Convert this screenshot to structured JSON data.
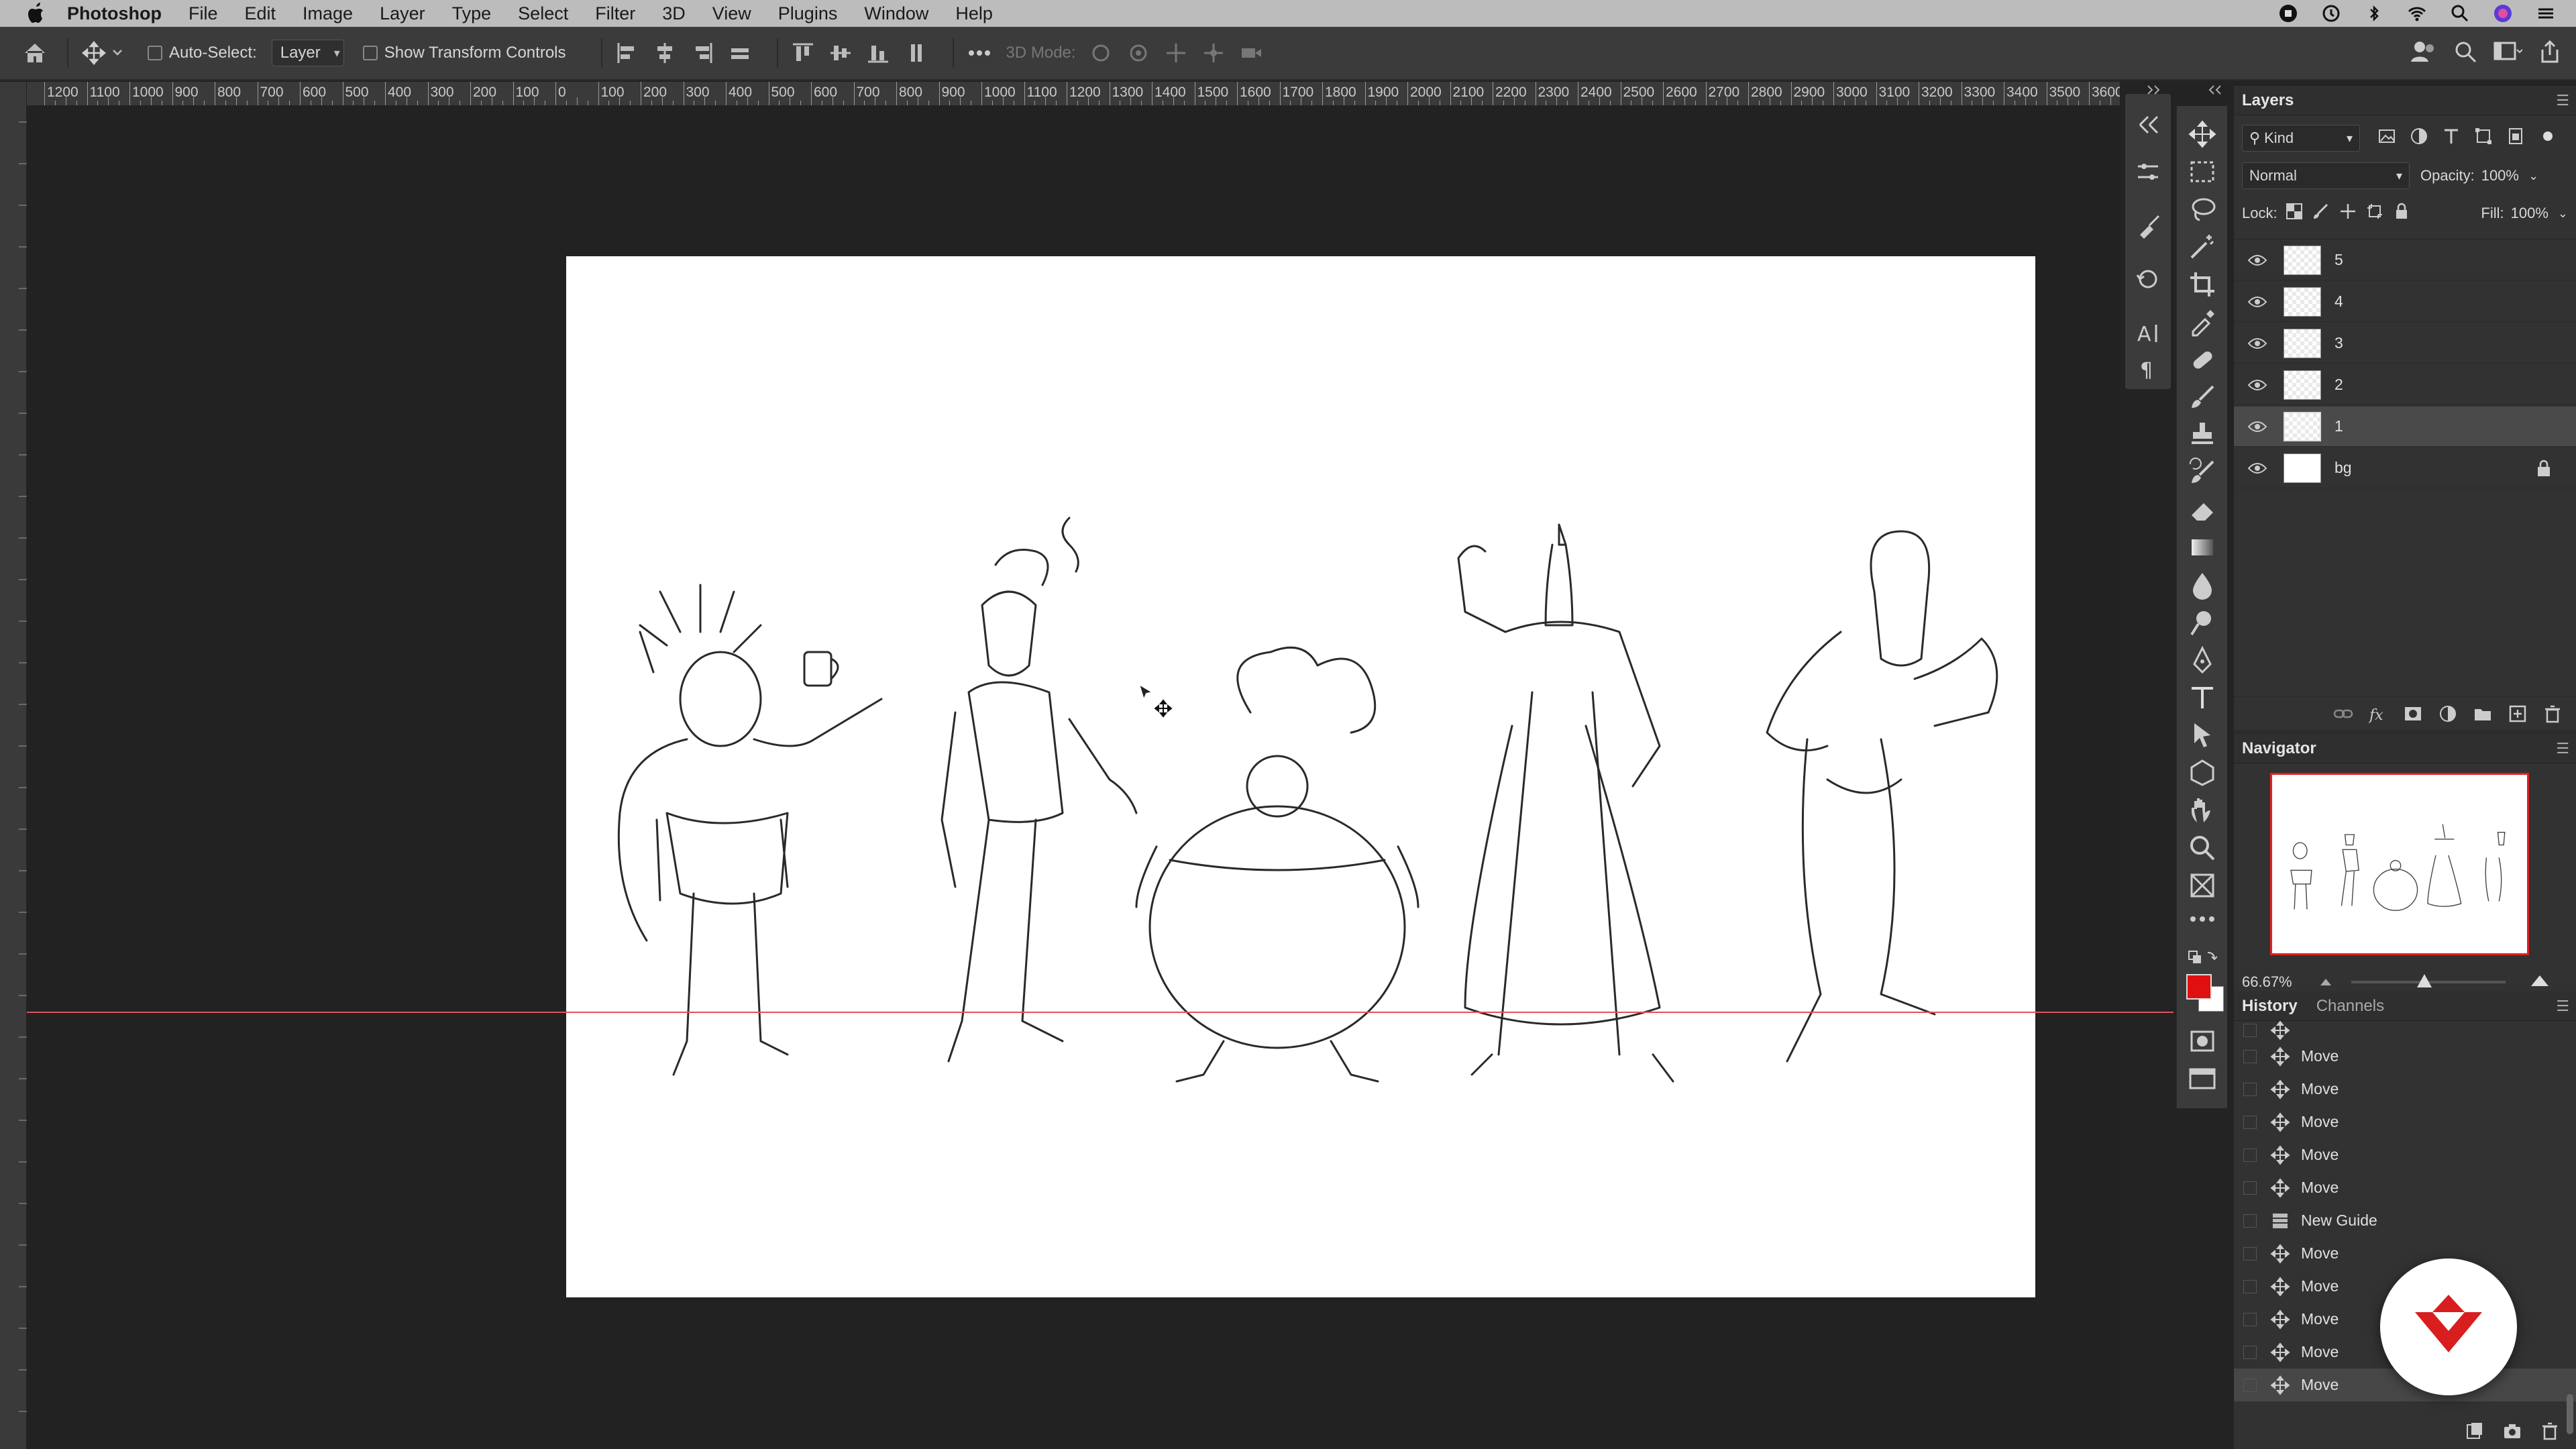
{
  "menubar": {
    "app": "Photoshop",
    "items": [
      "File",
      "Edit",
      "Image",
      "Layer",
      "Type",
      "Select",
      "Filter",
      "3D",
      "View",
      "Plugins",
      "Window",
      "Help"
    ]
  },
  "options": {
    "auto_select_label": "Auto-Select:",
    "auto_select_value": "Layer",
    "transform_label": "Show Transform Controls",
    "mode_3d_label": "3D Mode:"
  },
  "ruler": {
    "labels": [
      "1200",
      "1100",
      "1000",
      "900",
      "800",
      "700",
      "600",
      "500",
      "400",
      "300",
      "200",
      "100",
      "0",
      "100",
      "200",
      "300",
      "400",
      "500",
      "600",
      "700",
      "800",
      "900",
      "1000",
      "1100",
      "1200",
      "1300",
      "1400",
      "1500",
      "1600",
      "1700",
      "1800",
      "1900",
      "2000",
      "2100",
      "2200",
      "2300",
      "2400",
      "2500",
      "2600",
      "2700",
      "2800",
      "2900",
      "3000",
      "3100",
      "3200",
      "3300",
      "3400",
      "3500",
      "3600"
    ]
  },
  "layers": {
    "title": "Layers",
    "filter_kind": "Kind",
    "blend_mode": "Normal",
    "opacity_label": "Opacity:",
    "opacity_value": "100%",
    "lock_label": "Lock:",
    "fill_label": "Fill:",
    "fill_value": "100%",
    "items": [
      {
        "name": "5"
      },
      {
        "name": "4"
      },
      {
        "name": "3"
      },
      {
        "name": "2"
      },
      {
        "name": "1"
      },
      {
        "name": "bg"
      }
    ],
    "selected": "1"
  },
  "navigator": {
    "title": "Navigator",
    "zoom": "66.67%"
  },
  "history": {
    "tabs": [
      "History",
      "Channels"
    ],
    "items": [
      "Move",
      "Move",
      "Move",
      "Move",
      "Move",
      "New Guide",
      "Move",
      "Move",
      "Move",
      "Move",
      "Move"
    ]
  },
  "colors": {
    "foreground": "#e01010",
    "background": "#ffffff",
    "guide": "#e0525c",
    "accent_logo": "#d81e1e"
  }
}
